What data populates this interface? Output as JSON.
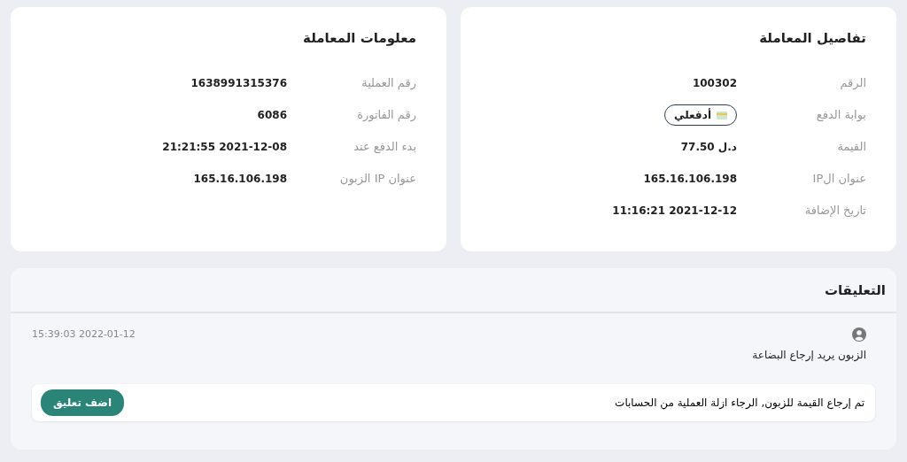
{
  "details_card": {
    "title": "تفاصيل المعاملة",
    "rows": [
      {
        "kind": "text",
        "label": "الرقم",
        "value": "100302"
      },
      {
        "kind": "gateway",
        "label": "بوابة الدفع",
        "value": "أدفعلي"
      },
      {
        "kind": "text",
        "label": "القيمة",
        "value": "77.50 د.ل"
      },
      {
        "kind": "text",
        "label": "عنوان الIP",
        "value": "165.16.106.198"
      },
      {
        "kind": "text",
        "label": "تاريخ الإضافة",
        "value": "11:16:21 2021-12-12"
      }
    ]
  },
  "info_card": {
    "title": "معلومات المعاملة",
    "rows": [
      {
        "kind": "text",
        "label": "رقم العملية",
        "value": "1638991315376"
      },
      {
        "kind": "text",
        "label": "رقم الفاتورة",
        "value": "6086"
      },
      {
        "kind": "text",
        "label": "بدء الدفع عند",
        "value": "21:21:55 2021-12-08"
      },
      {
        "kind": "text",
        "label": "عنوان IP الزبون",
        "value": "165.16.106.198"
      }
    ]
  },
  "comments": {
    "title": "التعليقات",
    "items": [
      {
        "text": "الزبون يريد إرجاع البضاعة",
        "time": "15:39:03 2022-01-12"
      }
    ],
    "input": {
      "value": "تم إرجاع القيمة للزبون, الرجاء ازلة العملية من الحسابات"
    },
    "button": "اضف تعليق"
  }
}
